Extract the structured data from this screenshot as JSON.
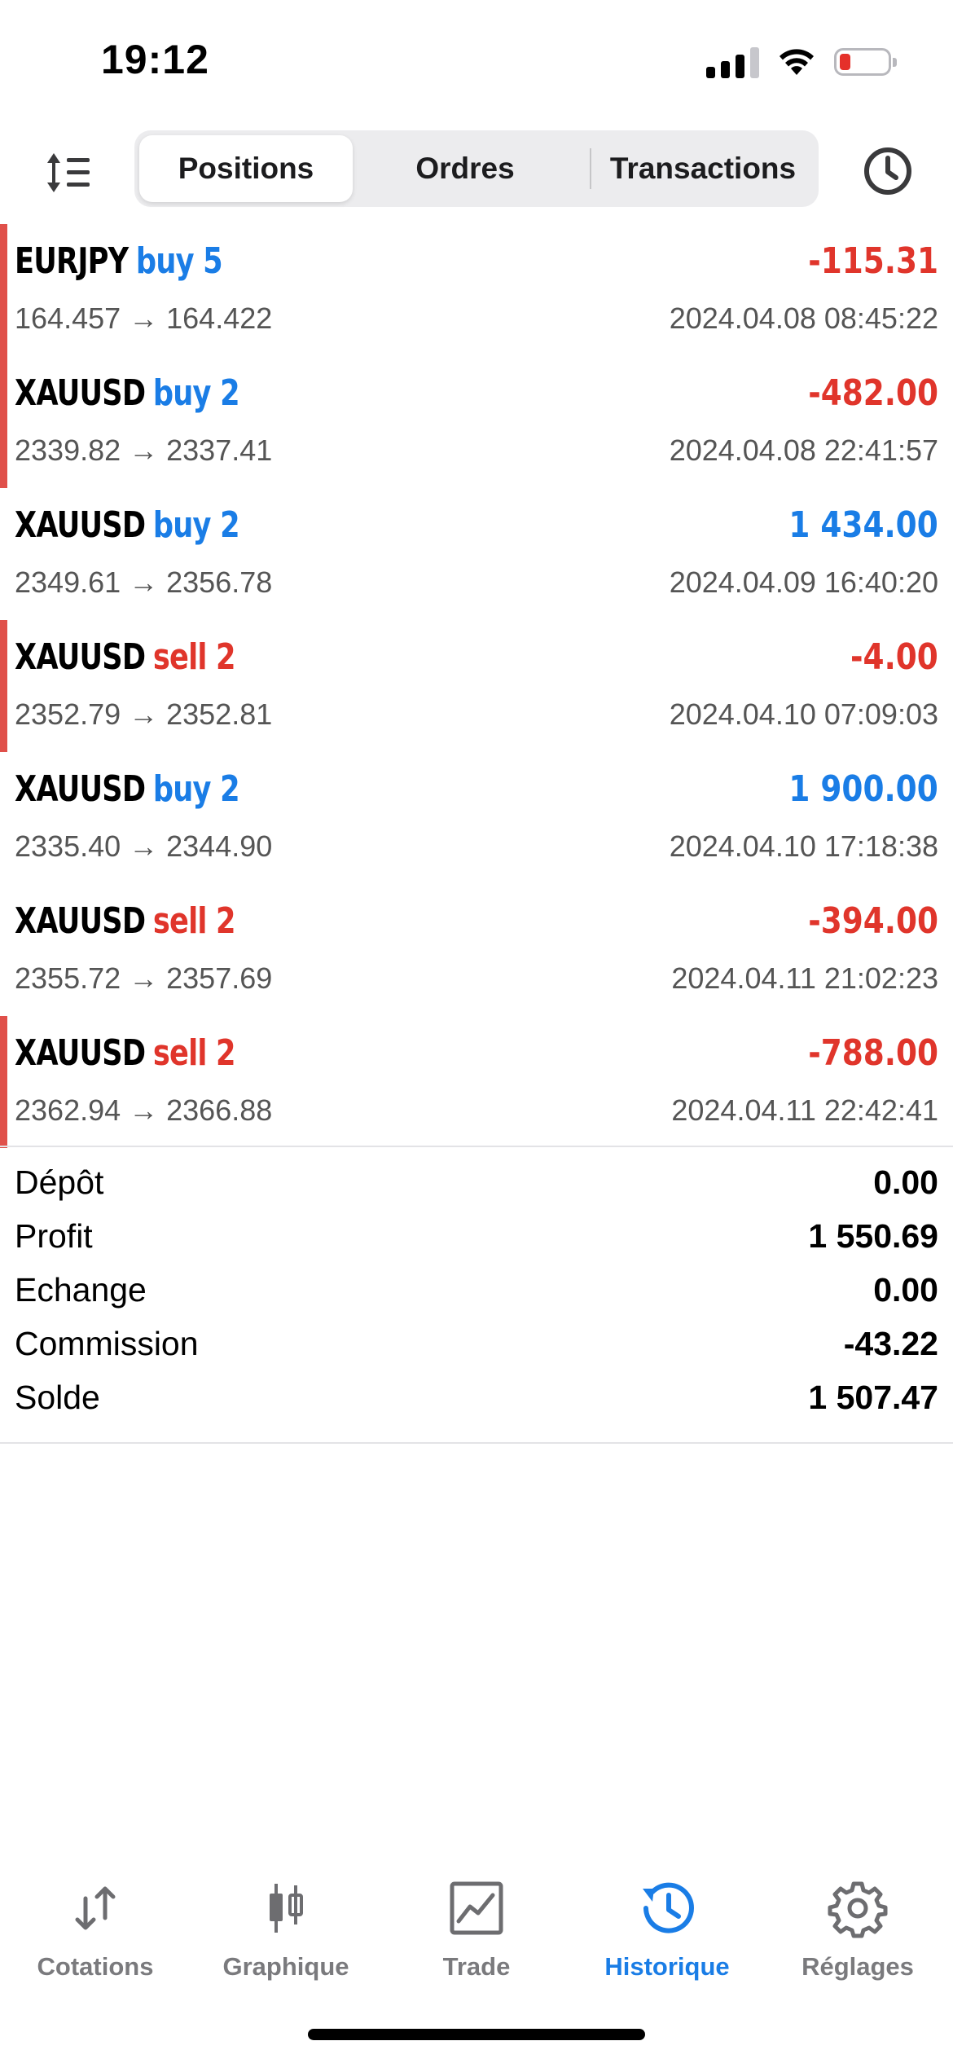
{
  "status_bar": {
    "time": "19:12"
  },
  "header": {
    "tabs": [
      {
        "label": "Positions",
        "active": true
      },
      {
        "label": "Ordres",
        "active": false
      },
      {
        "label": "Transactions",
        "active": false
      }
    ]
  },
  "deals": [
    {
      "symbol": "EURJPY",
      "action": "buy 5",
      "prices": "164.457 → 164.422",
      "profit": "-115.31",
      "time": "2024.04.08 08:45:22"
    },
    {
      "symbol": "XAUUSD",
      "action": "buy 2",
      "prices": "2339.82 → 2337.41",
      "profit": "-482.00",
      "time": "2024.04.08 22:41:57"
    },
    {
      "symbol": "XAUUSD",
      "action": "buy 2",
      "prices": "2349.61 → 2356.78",
      "profit": "1 434.00",
      "time": "2024.04.09 16:40:20"
    },
    {
      "symbol": "XAUUSD",
      "action": "sell 2",
      "prices": "2352.79 → 2352.81",
      "profit": "-4.00",
      "time": "2024.04.10 07:09:03"
    },
    {
      "symbol": "XAUUSD",
      "action": "buy 2",
      "prices": "2335.40 → 2344.90",
      "profit": "1 900.00",
      "time": "2024.04.10 17:18:38"
    },
    {
      "symbol": "XAUUSD",
      "action": "sell 2",
      "prices": "2355.72 → 2357.69",
      "profit": "-394.00",
      "time": "2024.04.11 21:02:23"
    },
    {
      "symbol": "XAUUSD",
      "action": "sell 2",
      "prices": "2362.94 → 2366.88",
      "profit": "-788.00",
      "time": "2024.04.11 22:42:41"
    }
  ],
  "summary": [
    {
      "label": "Dépôt",
      "value": "0.00"
    },
    {
      "label": "Profit",
      "value": "1 550.69"
    },
    {
      "label": "Echange",
      "value": "0.00"
    },
    {
      "label": "Commission",
      "value": "-43.22"
    },
    {
      "label": "Solde",
      "value": "1 507.47"
    }
  ],
  "tabbar": [
    {
      "label": "Cotations",
      "icon": "arrows-up-down-icon",
      "active": false
    },
    {
      "label": "Graphique",
      "icon": "candlestick-icon",
      "active": false
    },
    {
      "label": "Trade",
      "icon": "trade-chart-icon",
      "active": false
    },
    {
      "label": "Historique",
      "icon": "history-clock-icon",
      "active": true
    },
    {
      "label": "Réglages",
      "icon": "gear-icon",
      "active": false
    }
  ],
  "colors": {
    "buy": "#1a7de6",
    "sell": "#e0352b",
    "loss_marker": "#e0504a",
    "tab_active": "#1a7de6",
    "tab_inactive": "#7a7a7d"
  }
}
